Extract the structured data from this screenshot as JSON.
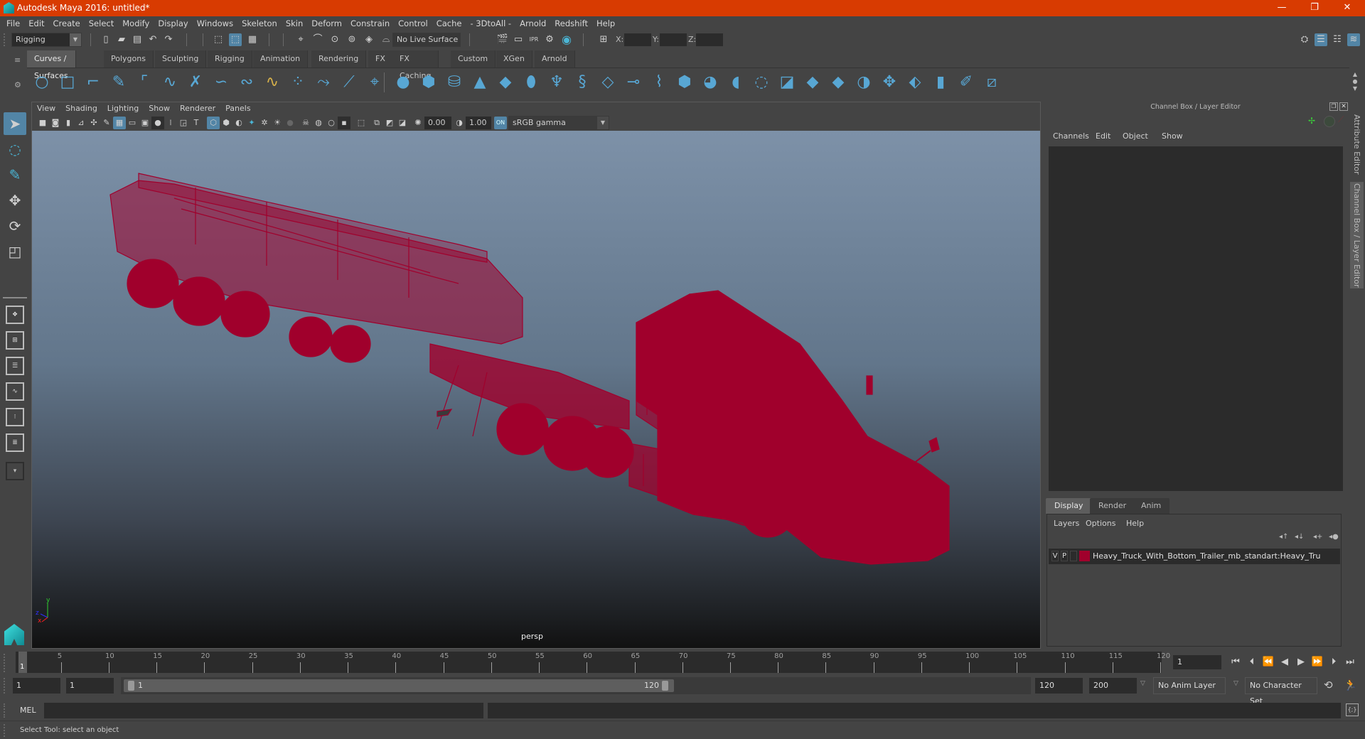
{
  "window": {
    "title": "Autodesk Maya 2016: untitled*",
    "controls": {
      "minimize": "—",
      "restore": "❐",
      "close": "✕"
    }
  },
  "menubar": [
    "File",
    "Edit",
    "Create",
    "Select",
    "Modify",
    "Display",
    "Windows",
    "Skeleton",
    "Skin",
    "Deform",
    "Constrain",
    "Control",
    "Cache",
    "- 3DtoAll -",
    "Arnold",
    "Redshift",
    "Help"
  ],
  "statusline": {
    "menuset": "Rigging",
    "live_surface": "No Live Surface",
    "x_label": "X:",
    "y_label": "Y:",
    "z_label": "Z:",
    "x_value": "",
    "y_value": "",
    "z_value": ""
  },
  "shelf": {
    "tabs": [
      "Curves / Surfaces",
      "Polygons",
      "Sculpting",
      "Rigging",
      "Animation",
      "Rendering",
      "FX",
      "FX Caching",
      "Custom",
      "XGen",
      "Arnold"
    ],
    "active_tab": "Curves / Surfaces"
  },
  "viewport": {
    "menu": [
      "View",
      "Shading",
      "Lighting",
      "Show",
      "Renderer",
      "Panels"
    ],
    "exposure": "0.00",
    "gamma": "1.00",
    "color_space": "sRGB gamma",
    "camera_label": "persp",
    "axis": {
      "x": "x",
      "y": "y",
      "z": "z"
    },
    "wireframe_color": "#a0002c"
  },
  "channelbox": {
    "title": "Channel Box / Layer Editor",
    "menu": [
      "Channels",
      "Edit",
      "Object",
      "Show"
    ],
    "layer_tabs": [
      "Display",
      "Render",
      "Anim"
    ],
    "active_layer_tab": "Display",
    "layer_menu": [
      "Layers",
      "Options",
      "Help"
    ],
    "layers": [
      {
        "visible": "V",
        "playback": "P",
        "color": "#a0002c",
        "name": "Heavy_Truck_With_Bottom_Trailer_mb_standart:Heavy_Tru"
      }
    ]
  },
  "side_tabs": [
    "Attribute Editor",
    "Channel Box / Layer Editor"
  ],
  "timeline": {
    "ticks": [
      "5",
      "10",
      "15",
      "20",
      "25",
      "30",
      "35",
      "40",
      "45",
      "50",
      "55",
      "60",
      "65",
      "70",
      "75",
      "80",
      "85",
      "90",
      "95",
      "100",
      "105",
      "110",
      "115",
      "120"
    ],
    "current_frame_marker": "1",
    "current_frame": "1"
  },
  "range": {
    "start_time": "1",
    "playback_start": "1",
    "slider_start": "1",
    "slider_end": "120",
    "playback_end": "120",
    "end_time": "200",
    "anim_layer": "No Anim Layer",
    "character_set": "No Character Set"
  },
  "command_line": {
    "language": "MEL",
    "input": "",
    "output": ""
  },
  "help_line": "Select Tool: select an object"
}
